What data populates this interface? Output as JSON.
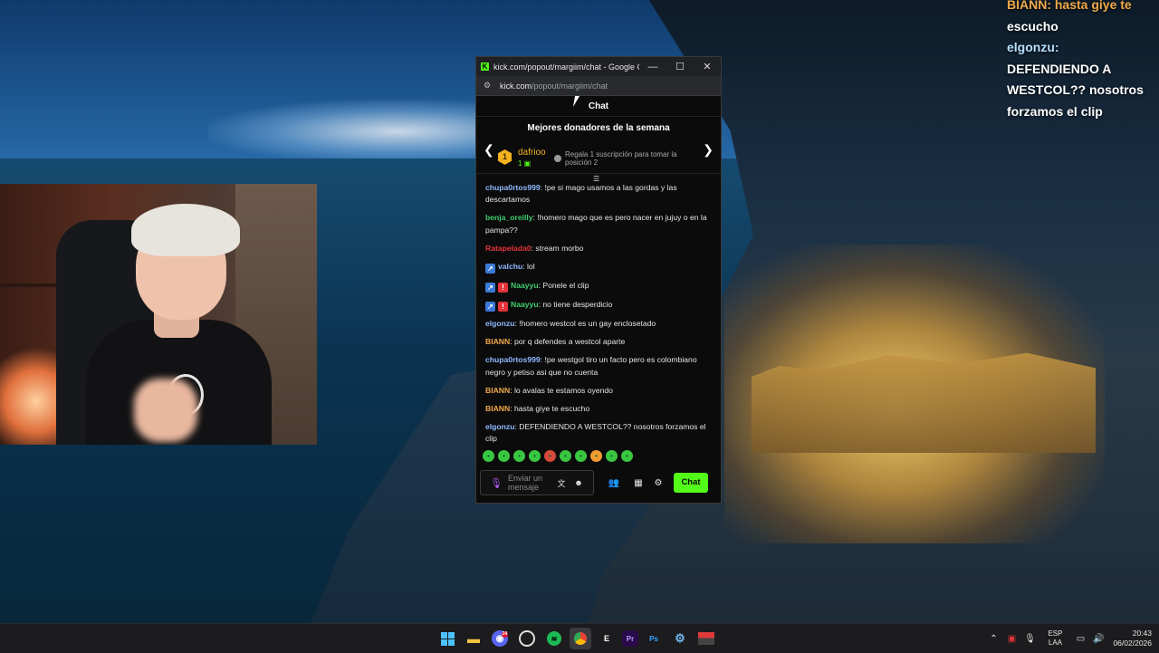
{
  "overlay_chat": {
    "lines": [
      "BIANN: hasta giye te",
      "escucho",
      "elgonzu:",
      "DEFENDIENDO A",
      "WESTCOL?? nosotros",
      "forzamos el clip"
    ]
  },
  "window": {
    "title": "kick.com/popout/margiim/chat - Google Chr...",
    "controls": {
      "minimize": "—",
      "maximize": "☐",
      "close": "✕"
    },
    "address_host": "kick.com",
    "address_path": "/popout/margiim/chat"
  },
  "chat": {
    "header": "Chat",
    "donors": {
      "title": "Mejores donadores de la semana",
      "rank": "1",
      "name": "dafrioo",
      "count": "1",
      "gift_text": "Regala 1 suscripción para tomar la posición 2"
    },
    "messages": [
      {
        "user": "chupa0rtos999",
        "color": "#8fb9ff",
        "badges": [],
        "text": ": !pe si mago usamos a las gordas y las descartamos"
      },
      {
        "user": "benja_oreilly",
        "color": "#3ccf6b",
        "badges": [],
        "text": ": !homero mago que es pero nacer en jujuy o en la pampa??"
      },
      {
        "user": "Ratapelada0",
        "color": "#e5333a",
        "badges": [],
        "text": ": stream morbo"
      },
      {
        "user": "valchu",
        "color": "#8fb9ff",
        "badges": [
          "tier"
        ],
        "text": ": lol"
      },
      {
        "user": "Naayyu",
        "color": "#3ccf6b",
        "badges": [
          "tier",
          "mod"
        ],
        "text": ": Ponele el clip"
      },
      {
        "user": "Naayyu",
        "color": "#3ccf6b",
        "badges": [
          "tier",
          "mod"
        ],
        "text": ": no tiene desperdicio"
      },
      {
        "user": "elgonzu",
        "color": "#8fb9ff",
        "badges": [],
        "text": ": !homero westcol es un gay enclosetado"
      },
      {
        "user": "BIANN",
        "color": "#f2a94a",
        "badges": [],
        "text": ": por q defendes a westcol aparte"
      },
      {
        "user": "chupa0rtos999",
        "color": "#8fb9ff",
        "badges": [],
        "text": ": !pe westgol tiro un facto pero es colombiano negro y petiso asi que no cuenta"
      },
      {
        "user": "BIANN",
        "color": "#f2a94a",
        "badges": [],
        "text": ": lo avalas te estamos oyendo"
      },
      {
        "user": "BIANN",
        "color": "#f2a94a",
        "badges": [],
        "text": ": hasta giye te escucho"
      },
      {
        "user": "elgonzu",
        "color": "#8fb9ff",
        "badges": [],
        "text": ": DEFENDIENDO A WESTCOL?? nosotros forzamos el clip"
      }
    ],
    "emote_count": 10,
    "input_placeholder": "Enviar un mensaje",
    "send_label": "Chat"
  },
  "taskbar": {
    "apps": [
      "start",
      "file-explorer",
      "discord",
      "obs",
      "spotify",
      "chrome",
      "epic-games",
      "premiere",
      "photoshop",
      "steam",
      "app-thumbnail"
    ],
    "discord_badge": "24",
    "tray": {
      "lang_line1": "ESP",
      "lang_line2": "LAA",
      "time": "20:43",
      "date": "06/02/2026"
    }
  }
}
